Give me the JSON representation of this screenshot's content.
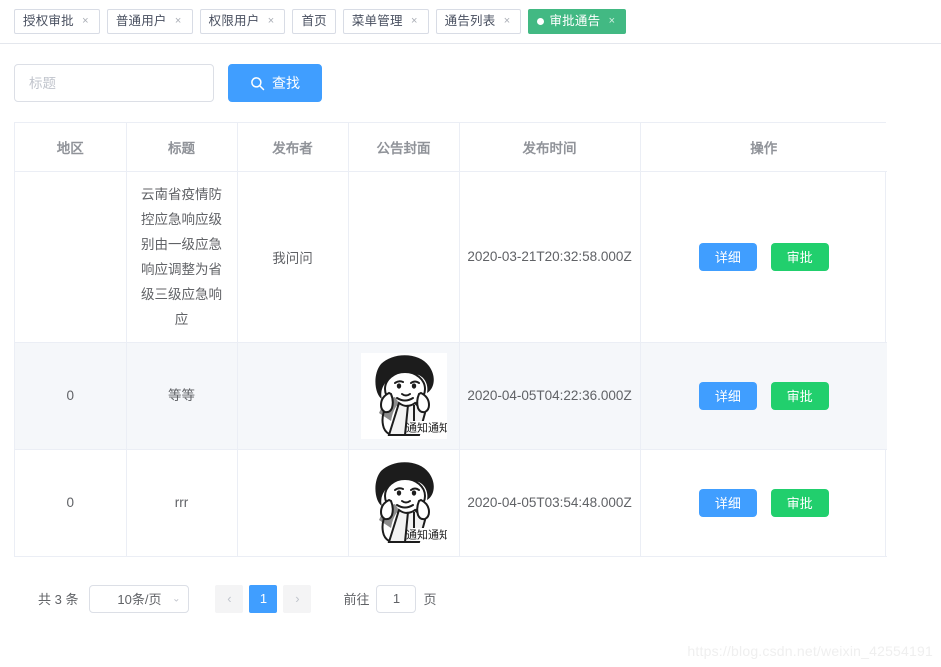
{
  "tabs": [
    {
      "label": "授权审批",
      "closable": true,
      "active": false
    },
    {
      "label": "普通用户",
      "closable": true,
      "active": false
    },
    {
      "label": "权限用户",
      "closable": true,
      "active": false
    },
    {
      "label": "首页",
      "closable": false,
      "active": false
    },
    {
      "label": "菜单管理",
      "closable": true,
      "active": false
    },
    {
      "label": "通告列表",
      "closable": true,
      "active": false
    },
    {
      "label": "审批通告",
      "closable": true,
      "active": true
    }
  ],
  "tab_close_glyph": "×",
  "toolbar": {
    "search_placeholder": "标题",
    "search_value": "",
    "search_button_label": "查找",
    "search_icon": "search-icon"
  },
  "table": {
    "columns": [
      "地区",
      "标题",
      "发布者",
      "公告封面",
      "发布时间",
      "操作"
    ],
    "rows": [
      {
        "region": "",
        "title": "云南省疫情防控应急响应级别由一级应急响应调整为省级三级应急响应",
        "publisher": "我问问",
        "cover": "",
        "cover_caption": "",
        "publish_time": "2020-03-21T20:32:58.000Z",
        "detail_label": "详细",
        "approve_label": "审批"
      },
      {
        "region": "0",
        "title": "等等",
        "publisher": "",
        "cover": "notice-meme-image",
        "cover_caption": "通知通知",
        "publish_time": "2020-04-05T04:22:36.000Z",
        "detail_label": "详细",
        "approve_label": "审批"
      },
      {
        "region": "0",
        "title": "rrr",
        "publisher": "",
        "cover": "notice-meme-image",
        "cover_caption": "通知通知",
        "publish_time": "2020-04-05T03:54:48.000Z",
        "detail_label": "详细",
        "approve_label": "审批"
      }
    ]
  },
  "pagination": {
    "total_label": "共 3 条",
    "page_size_label": "10条/页",
    "prev_glyph": "‹",
    "next_glyph": "›",
    "current_page": "1",
    "jump_prefix": "前往",
    "jump_value": "1",
    "jump_suffix": "页",
    "caret_glyph": "⌄"
  },
  "watermark": "https://blog.csdn.net/weixin_42554191",
  "colors": {
    "primary_blue": "#409eff",
    "success_green": "#21cf6d",
    "active_tab_green": "#42b983",
    "border": "#ebeef5",
    "striped_row": "#f5f7fa"
  }
}
